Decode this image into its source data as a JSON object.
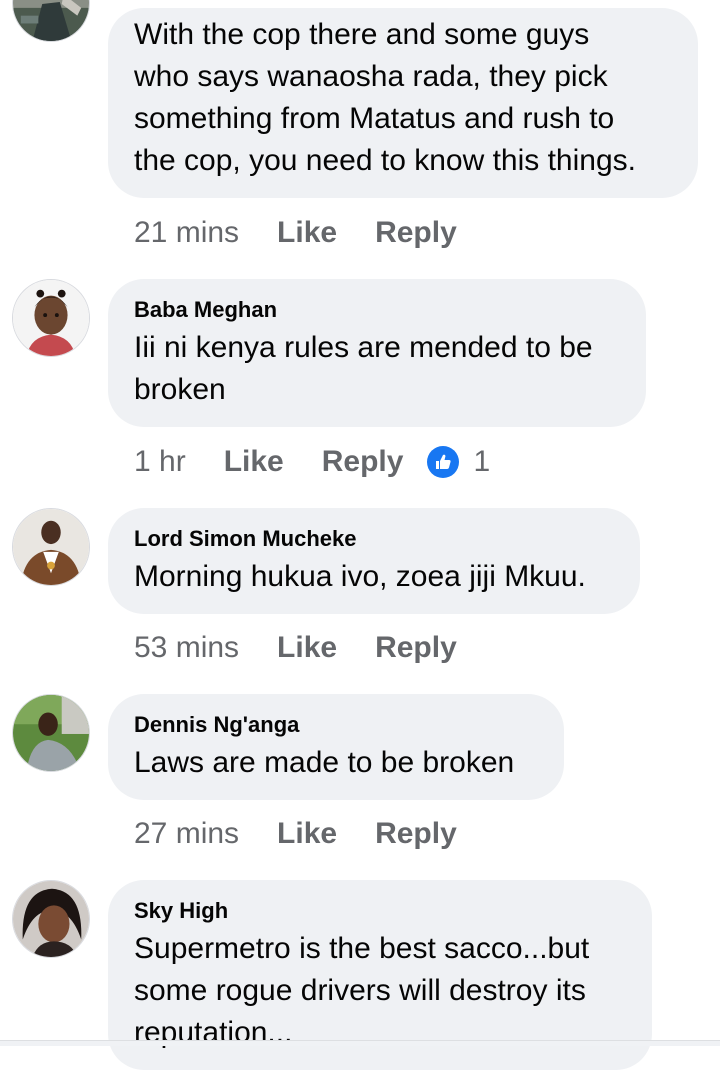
{
  "comments": [
    {
      "author": "",
      "lines": [
        "With the cop there and some guys",
        "who says wanaosha rada, they pick",
        "something from Matatus and rush to",
        "the cop, you need to know this things."
      ],
      "time": "21 mins",
      "like_label": "Like",
      "reply_label": "Reply"
    },
    {
      "author": "Baba Meghan",
      "lines": [
        "Iii ni kenya rules are mended to be",
        "broken"
      ],
      "time": "1 hr",
      "like_label": "Like",
      "reply_label": "Reply",
      "reaction_count": "1"
    },
    {
      "author": "Lord Simon Mucheke",
      "lines": [
        "Morning hukua ivo, zoea jiji Mkuu."
      ],
      "time": "53 mins",
      "like_label": "Like",
      "reply_label": "Reply"
    },
    {
      "author": "Dennis Ng'anga",
      "lines": [
        "Laws are made to be broken"
      ],
      "time": "27 mins",
      "like_label": "Like",
      "reply_label": "Reply"
    },
    {
      "author": "Sky High",
      "lines": [
        "Supermetro is the best sacco...but",
        "some rogue drivers will destroy its",
        "reputation..."
      ]
    }
  ],
  "colors": {
    "bubble": "#eff1f4",
    "meta_text": "#65676b",
    "like_badge": "#1877f2"
  }
}
